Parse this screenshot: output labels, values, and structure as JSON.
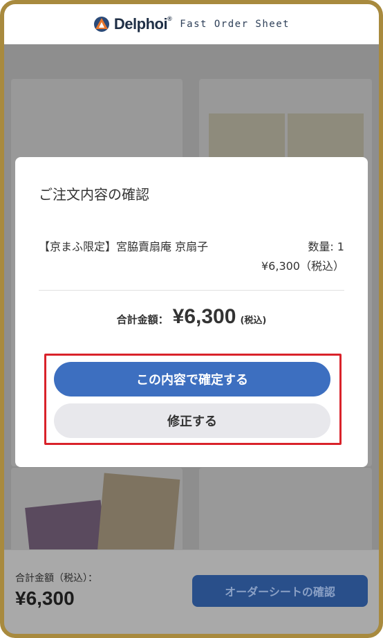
{
  "header": {
    "brand": "Delphoi",
    "brand_mark": "®",
    "subtitle": "Fast Order Sheet"
  },
  "modal": {
    "title": "ご注文内容の確認",
    "item": {
      "name": "【京まふ限定】宮脇賣扇庵 京扇子",
      "quantity": "数量: 1",
      "price": "¥6,300（税込）"
    },
    "total_label": "合計金額：",
    "total_amount": "¥6,300",
    "total_tax": "(税込)",
    "confirm_button": "この内容で確定する",
    "edit_button": "修正する"
  },
  "bottom_bar": {
    "label": "合計金額（税込）：",
    "total": "¥6,300",
    "button": "オーダーシートの確認"
  },
  "colors": {
    "frame": "#a88a3e",
    "primary": "#3d6fc0",
    "highlight": "#d9222a"
  }
}
